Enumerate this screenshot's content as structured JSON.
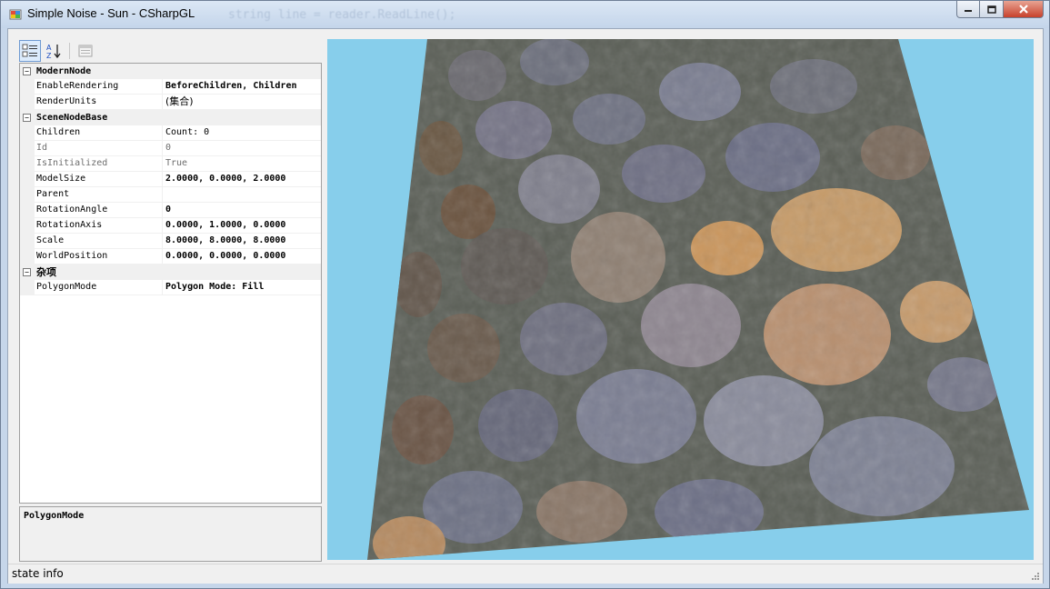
{
  "window": {
    "title": "Simple Noise - Sun - CSharpGL",
    "ghost_text": "string line = reader.ReadLine();"
  },
  "toolbar": {
    "categorized_icon": "categorized-icon",
    "alphabetical_icon": "alphabetical-icon",
    "property_pages_icon": "property-pages-icon"
  },
  "property_grid": {
    "categories": [
      {
        "name": "ModernNode",
        "properties": [
          {
            "name": "EnableRendering",
            "value": "BeforeChildren, Children"
          },
          {
            "name": "RenderUnits",
            "value": "(集合)"
          }
        ]
      },
      {
        "name": "SceneNodeBase",
        "properties": [
          {
            "name": "Children",
            "value": "Count: 0"
          },
          {
            "name": "Id",
            "value": "0"
          },
          {
            "name": "IsInitialized",
            "value": "True"
          },
          {
            "name": "ModelSize",
            "value": "2.0000, 0.0000, 2.0000"
          },
          {
            "name": "Parent",
            "value": ""
          },
          {
            "name": "RotationAngle",
            "value": "0"
          },
          {
            "name": "RotationAxis",
            "value": "0.0000, 1.0000, 0.0000"
          },
          {
            "name": "Scale",
            "value": "8.0000, 8.0000, 8.0000"
          },
          {
            "name": "WorldPosition",
            "value": "0.0000, 0.0000, 0.0000"
          }
        ]
      },
      {
        "name": "杂项",
        "properties": [
          {
            "name": "PolygonMode",
            "value": "Polygon Mode: Fill"
          }
        ]
      }
    ]
  },
  "description": {
    "title": "PolygonMode"
  },
  "status": {
    "text": "state info"
  },
  "viewport": {
    "background": "#87ceeb",
    "ground": "#5b5f57"
  }
}
